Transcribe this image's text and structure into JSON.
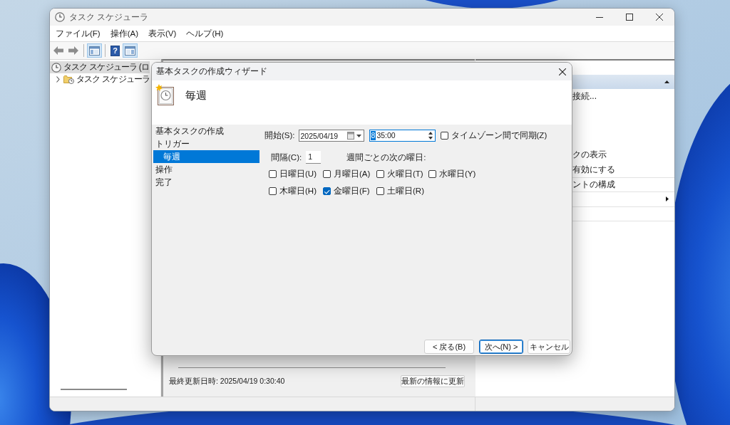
{
  "window": {
    "title": "タスク スケジューラ"
  },
  "menu": [
    "ファイル(F)",
    "操作(A)",
    "表示(V)",
    "ヘルプ(H)"
  ],
  "toolbar": [
    {
      "kind": "back"
    },
    {
      "kind": "forward"
    },
    {
      "kind": "separator"
    },
    {
      "kind": "console_tree",
      "pressed": true
    },
    {
      "kind": "separator"
    },
    {
      "kind": "help",
      "glyph": "?",
      "pressed": false
    },
    {
      "kind": "action_pane",
      "pressed": true
    }
  ],
  "tree": [
    {
      "label": "タスク スケジューラ (ロ",
      "selected": true,
      "children": [
        {
          "label": "タスク スケジューラ",
          "selected": false,
          "expanded": false
        }
      ]
    }
  ],
  "details": {
    "last_updated": "最終更新日時: 2025/04/19 0:30:40",
    "refresh_button": "最新の情報に更新"
  },
  "actions": {
    "section_expanded": true,
    "items": [
      {
        "kind": "link",
        "label": "接続..."
      },
      {
        "kind": "link",
        "label": "クの表示"
      },
      {
        "kind": "link",
        "label": "有効にする"
      },
      {
        "kind": "link",
        "label": "ントの構成"
      },
      {
        "kind": "submenu"
      }
    ]
  },
  "dialog": {
    "title": "基本タスクの作成ウィザード",
    "heading": "毎週",
    "steps": [
      {
        "label": "基本タスクの作成",
        "selected": false
      },
      {
        "label": "トリガー",
        "selected": false,
        "children": [
          {
            "label": "毎週",
            "selected": true
          }
        ]
      },
      {
        "label": "操作",
        "selected": false
      },
      {
        "label": "完了",
        "selected": false
      }
    ],
    "start": {
      "label": "開始(S):",
      "date": "2025/04/19",
      "time": {
        "focused": true,
        "segments": [
          {
            "text": "8",
            "selected": true
          },
          {
            "text": "35:00",
            "selected": false
          }
        ]
      },
      "sync": {
        "label": "タイムゾーン間で同期(Z)",
        "checked": false
      }
    },
    "interval": {
      "label": "間隔(C):",
      "value": "1",
      "suffix": "週間ごとの次の曜日:"
    },
    "days": [
      {
        "label": "日曜日(U)",
        "checked": false
      },
      {
        "label": "月曜日(A)",
        "checked": false
      },
      {
        "label": "火曜日(T)",
        "checked": false
      },
      {
        "label": "水曜日(Y)",
        "checked": false
      },
      {
        "label": "木曜日(H)",
        "checked": false
      },
      {
        "label": "金曜日(F)",
        "checked": true
      },
      {
        "label": "土曜日(R)",
        "checked": false
      }
    ],
    "buttons": [
      {
        "label": "< 戻る(B)",
        "default": false
      },
      {
        "label": "次へ(N) >",
        "default": true
      },
      {
        "label": "キャンセル",
        "default": false
      }
    ]
  }
}
